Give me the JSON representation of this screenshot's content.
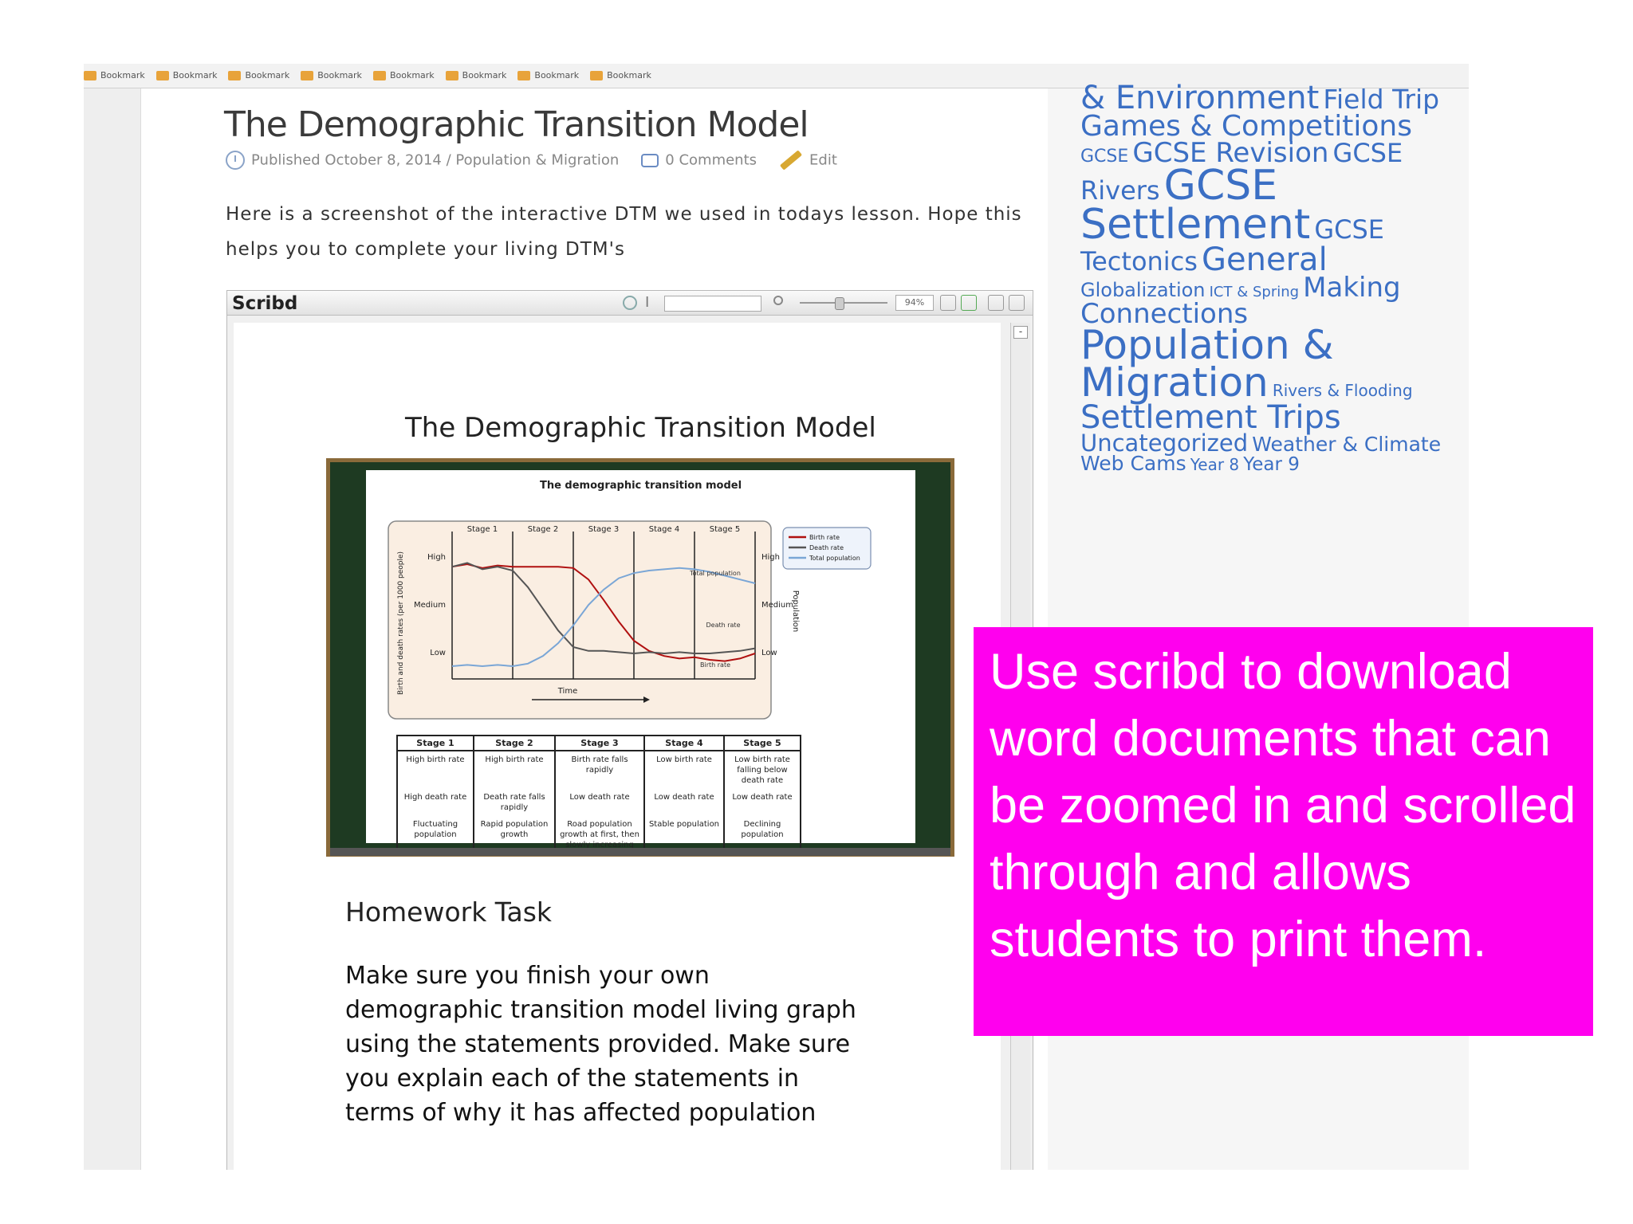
{
  "bookmarks": [
    "Bookmark",
    "Bookmark",
    "Bookmark",
    "Bookmark",
    "Bookmark",
    "Bookmark",
    "Bookmark",
    "Bookmark"
  ],
  "post": {
    "title": "The Demographic Transition Model",
    "published": "Published October 8, 2014",
    "category": "Population & Migration",
    "comments": "0 Comments",
    "edit": "Edit",
    "intro": "Here is a screenshot of the interactive DTM we used in todays lesson. Hope this helps you to complete your living DTM's"
  },
  "scribd": {
    "logo": "Scribd",
    "zoom": "94%",
    "doc_title": "The Demographic Transition Model",
    "chart_title": "The demographic transition model",
    "homework_title": "Homework Task",
    "homework_text": "Make sure you finish your own demographic transition model living graph using the statements provided. Make sure you explain each of the statements in terms of why it has affected population"
  },
  "chart_data": {
    "type": "line",
    "title": "The demographic transition model",
    "xlabel": "Time",
    "ylabel": "Birth and death rates (per 1000 people)",
    "y2label": "Population",
    "stages": [
      "Stage 1",
      "Stage 2",
      "Stage 3",
      "Stage 4",
      "Stage 5"
    ],
    "y_levels": [
      "High",
      "Medium",
      "Low"
    ],
    "y2_levels": [
      "High",
      "Medium",
      "Low"
    ],
    "annotations": [
      "Total population",
      "Death rate",
      "Birth rate"
    ],
    "x": [
      0,
      5,
      10,
      15,
      20,
      25,
      30,
      35,
      40,
      45,
      50,
      55,
      60,
      65,
      70,
      75,
      80,
      85,
      90,
      95,
      100
    ],
    "series": [
      {
        "name": "Birth rate",
        "color": "#b01010",
        "values": [
          88,
          90,
          87,
          89,
          88,
          88,
          88,
          88,
          87,
          78,
          62,
          45,
          30,
          22,
          18,
          16,
          17,
          15,
          14,
          16,
          20
        ]
      },
      {
        "name": "Death rate",
        "color": "#555555",
        "values": [
          88,
          91,
          86,
          88,
          85,
          72,
          55,
          38,
          25,
          22,
          22,
          21,
          20,
          21,
          20,
          21,
          20,
          20,
          21,
          22,
          24
        ]
      },
      {
        "name": "Total population",
        "color": "#7aa6d6",
        "values": [
          10,
          11,
          10,
          11,
          10,
          12,
          18,
          28,
          42,
          58,
          70,
          79,
          83,
          85,
          86,
          87,
          86,
          84,
          81,
          78,
          75
        ]
      }
    ]
  },
  "table": {
    "headers": [
      "Stage 1",
      "Stage 2",
      "Stage 3",
      "Stage 4",
      "Stage 5"
    ],
    "rows": [
      [
        "High birth rate",
        "High birth rate",
        "Birth rate falls rapidly",
        "Low birth rate",
        "Low birth rate falling below death rate"
      ],
      [
        "High death rate",
        "Death rate falls rapidly",
        "Low death rate",
        "Low death rate",
        "Low death rate"
      ],
      [
        "Fluctuating population",
        "Rapid population growth",
        "Road population growth at first, then slowly increasing",
        "Stable population",
        "Declining population"
      ]
    ]
  },
  "sidebar": {
    "tags": [
      {
        "text": "& Environment",
        "size": 40
      },
      {
        "text": "Field Trip",
        "size": 33
      },
      {
        "text": "Games & Competitions",
        "size": 36
      },
      {
        "text": "GCSE",
        "size": 22
      },
      {
        "text": "GCSE Revision",
        "size": 34
      },
      {
        "text": "GCSE Rivers",
        "size": 32
      },
      {
        "text": "GCSE Settlement",
        "size": 52
      },
      {
        "text": "GCSE Tectonics",
        "size": 32
      },
      {
        "text": "General",
        "size": 40
      },
      {
        "text": "Globalization",
        "size": 24
      },
      {
        "text": "ICT & Spring",
        "size": 18
      },
      {
        "text": "Making Connections",
        "size": 34
      },
      {
        "text": "Population & Migration",
        "size": 50
      },
      {
        "text": "Rivers & Flooding",
        "size": 20
      },
      {
        "text": "Settlement Trips",
        "size": 40
      },
      {
        "text": "Uncategorized",
        "size": 29
      },
      {
        "text": "Weather & Climate",
        "size": 25
      },
      {
        "text": "Web Cams",
        "size": 25
      },
      {
        "text": "Year 8",
        "size": 20
      },
      {
        "text": "Year 9",
        "size": 23
      }
    ]
  },
  "callout": {
    "text": "Use scribd to download word documents that can be zoomed in and scrolled through and allows students to print them."
  }
}
